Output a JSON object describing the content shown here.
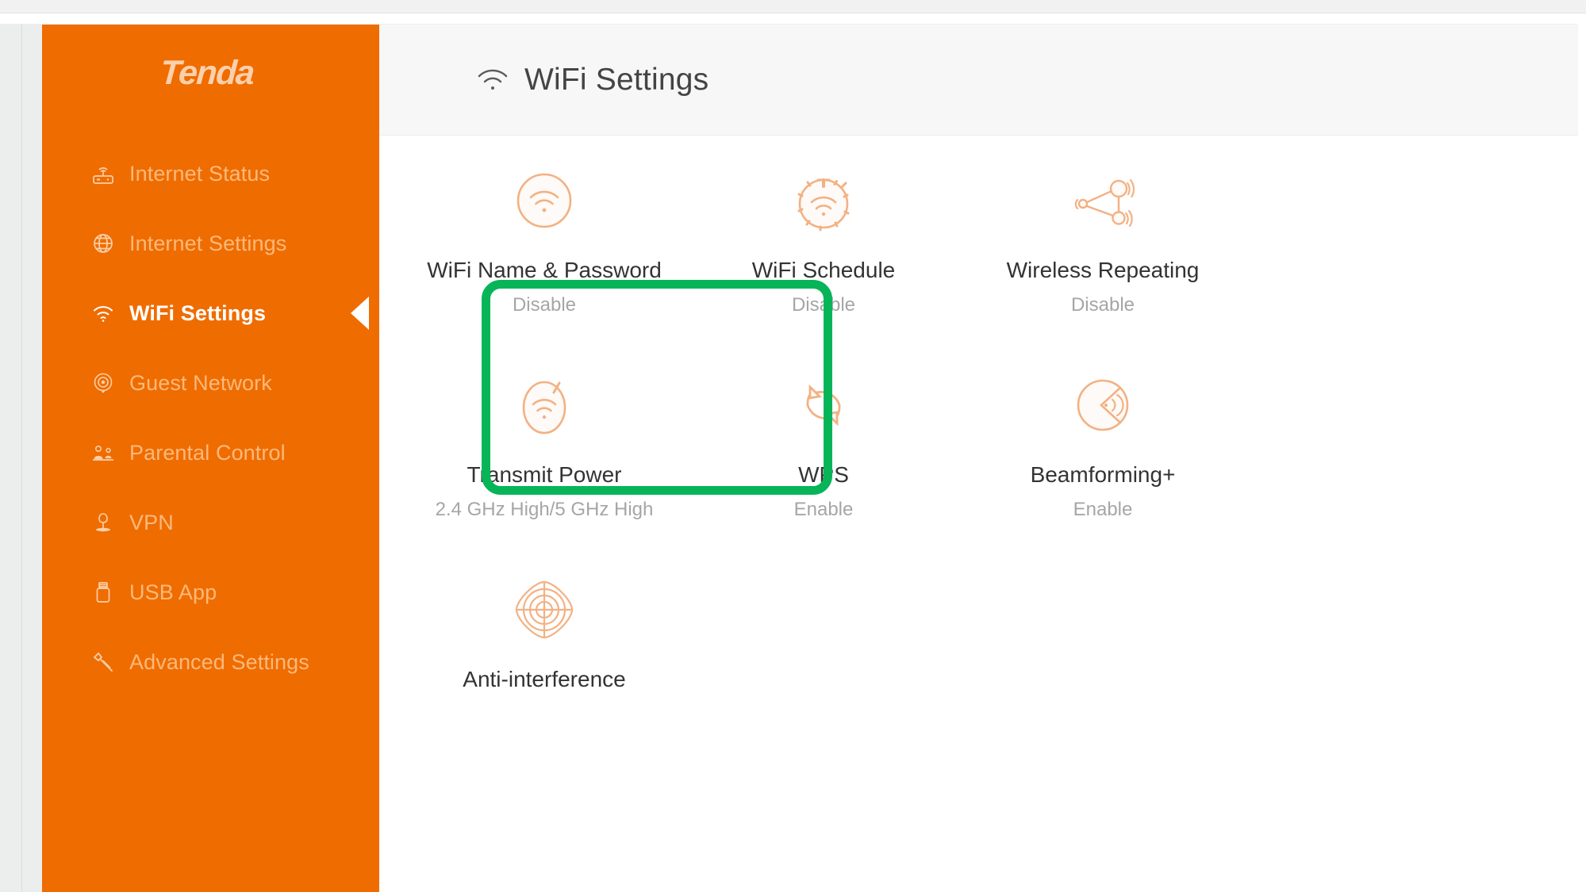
{
  "brand": {
    "logo_text": "Tenda"
  },
  "sidebar": {
    "items": [
      {
        "label": "Internet Status",
        "icon": "router-icon",
        "active": false
      },
      {
        "label": "Internet Settings",
        "icon": "globe-icon",
        "active": false
      },
      {
        "label": "WiFi Settings",
        "icon": "wifi-icon",
        "active": true
      },
      {
        "label": "Guest Network",
        "icon": "guest-network-icon",
        "active": false
      },
      {
        "label": "Parental Control",
        "icon": "parental-control-icon",
        "active": false
      },
      {
        "label": "VPN",
        "icon": "vpn-icon",
        "active": false
      },
      {
        "label": "USB App",
        "icon": "usb-icon",
        "active": false
      },
      {
        "label": "Advanced Settings",
        "icon": "wrench-icon",
        "active": false
      }
    ]
  },
  "header": {
    "icon": "wifi-icon",
    "title": "WiFi Settings"
  },
  "colors": {
    "brand_orange": "#ef6c00",
    "icon_orange": "#f5b183",
    "highlight_green": "#07b558",
    "title_gray": "#333333",
    "status_gray": "#a6a6a6"
  },
  "main": {
    "rows": [
      {
        "cards": [
          {
            "title": "WiFi Name & Password",
            "status": "Disable",
            "icon": "wifi-circle-icon",
            "highlighted": true
          },
          {
            "title": "WiFi Schedule",
            "status": "Disable",
            "icon": "wifi-timer-icon",
            "highlighted": false
          },
          {
            "title": "Wireless Repeating",
            "status": "Disable",
            "icon": "wireless-repeating-icon",
            "highlighted": false
          }
        ]
      },
      {
        "cards": [
          {
            "title": "Transmit Power",
            "status": "2.4 GHz High/5 GHz High",
            "icon": "transmit-power-icon",
            "highlighted": false
          },
          {
            "title": "WPS",
            "status": "Enable",
            "icon": "wps-refresh-icon",
            "highlighted": false
          },
          {
            "title": "Beamforming+",
            "status": "Enable",
            "icon": "beamforming-icon",
            "highlighted": false
          }
        ]
      },
      {
        "cards": [
          {
            "title": "Anti-interference",
            "status": "",
            "icon": "anti-interference-icon",
            "highlighted": false
          }
        ]
      }
    ]
  }
}
